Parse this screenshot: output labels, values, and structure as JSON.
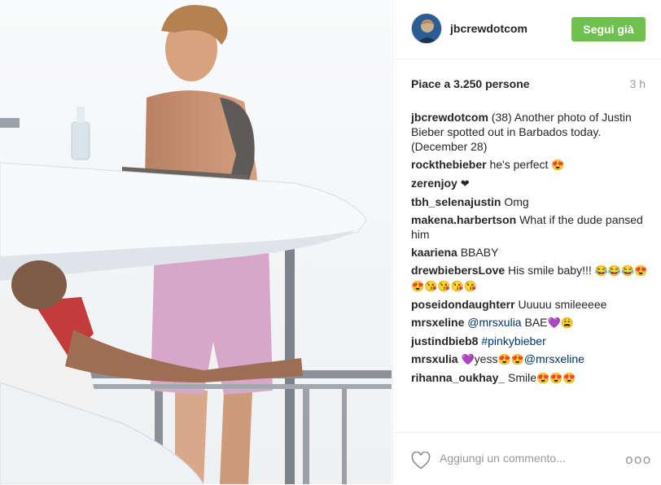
{
  "header": {
    "username": "jbcrewdotcom",
    "follow_label": "Segui già"
  },
  "post": {
    "likes": "Piace a 3.250 persone",
    "time": "3 h",
    "caption_user": "jbcrewdotcom",
    "caption_text": "(38) Another photo of Justin Bieber spotted out in Barbados today. (December 28)"
  },
  "comments": [
    {
      "user": "rockthebieber",
      "text": "he's perfect",
      "emoji": "😍"
    },
    {
      "user": "zerenjoy",
      "text": "",
      "emoji": "❤"
    },
    {
      "user": "tbh_selenajustin",
      "text": "Omg",
      "emoji": ""
    },
    {
      "user": "makena.harbertson",
      "text": "What if the dude pansed him",
      "emoji": ""
    },
    {
      "user": "kaariena",
      "text": "BBABY",
      "emoji": ""
    },
    {
      "user": "drewbiebersLove",
      "text": "His smile baby!!!",
      "emoji": "😂😂😂😍😍😘😘😘😘"
    },
    {
      "user": "poseidondaughterr",
      "text": "Uuuuu smileeeee",
      "emoji": ""
    },
    {
      "user": "mrsxeline",
      "mention": "@mrsxulia",
      "text": "BAE",
      "emoji": "💜😩"
    },
    {
      "user": "justindbieb8",
      "mention": "#pinkybieber",
      "text": "",
      "emoji": ""
    },
    {
      "user": "mrsxulia",
      "emoji_before": "💜",
      "text": "yess",
      "emoji": "😍😍",
      "mention_after": "@mrsxeline"
    },
    {
      "user": "rihanna_oukhay_",
      "text": "Smile",
      "emoji": "😍😍😍"
    }
  ],
  "footer": {
    "comment_placeholder": "Aggiungi un commento...",
    "more_label": "ooo"
  },
  "icons": {
    "like": "heart-outline-icon",
    "more": "more-options-icon",
    "avatar": "avatar"
  },
  "colors": {
    "follow_button": "#70c050",
    "mention": "#003569",
    "muted": "#999999"
  }
}
